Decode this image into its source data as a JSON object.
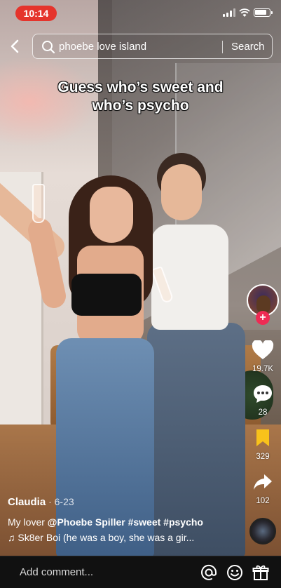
{
  "status": {
    "time": "10:14"
  },
  "search": {
    "query": "phoebe love island",
    "button_label": "Search"
  },
  "overlay": {
    "line1": "Guess who’s sweet and",
    "line2": "who’s psycho"
  },
  "rail": {
    "likes": "19.7K",
    "comments": "28",
    "saves": "329",
    "shares": "102",
    "follow": "+"
  },
  "post": {
    "author": "Claudia",
    "date": " · 6-23",
    "caption_prefix": "My lover ",
    "caption_mention": "@Phoebe Spiller",
    "caption_tags": " #sweet #psycho",
    "music": "♫ Sk8er Boi (he was a boy, she was a gir..."
  },
  "comment_bar": {
    "placeholder": "Add comment..."
  },
  "colors": {
    "accent": "#ee2b54",
    "time_pill": "#e5342c",
    "save": "#f8c21b"
  }
}
